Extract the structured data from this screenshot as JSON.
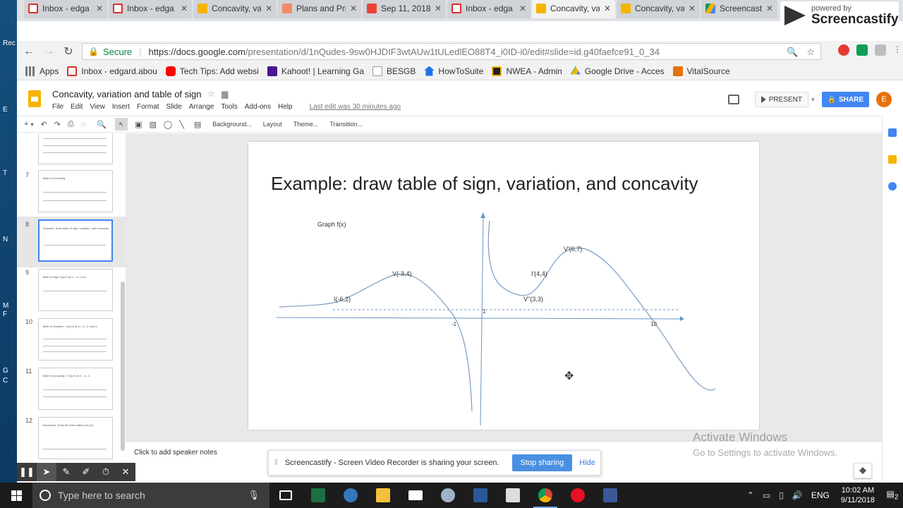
{
  "desktop": {
    "labels": [
      "Rec",
      "E",
      "T",
      "N",
      "M",
      "F",
      "G",
      "C"
    ]
  },
  "tabs": [
    {
      "label": "Inbox - edga",
      "icon": "gmail-icon"
    },
    {
      "label": "Inbox - edga",
      "icon": "gmail-icon"
    },
    {
      "label": "Concavity, va",
      "icon": "slides-icon"
    },
    {
      "label": "Plans and Pri",
      "icon": "plans-icon"
    },
    {
      "label": "Sep 11, 2018",
      "icon": "video-icon"
    },
    {
      "label": "Inbox - edga",
      "icon": "gmail-icon"
    },
    {
      "label": "Concavity, va",
      "icon": "slides-icon",
      "active": true
    },
    {
      "label": "Concavity, va",
      "icon": "slides-icon"
    },
    {
      "label": "Screencastify",
      "icon": "drive-icon"
    }
  ],
  "screencastify_badge": {
    "small": "powered by",
    "big": "Screencastify"
  },
  "omnibox": {
    "secure": "Secure",
    "url_host": "https://docs.google.com",
    "url_path": "/presentation/d/1nQudes-9sw0HJDIF3wtAUw1tULedlEO88T4_i0ID-i0/edit#slide=id.g40faefce91_0_34"
  },
  "bookmarks": [
    {
      "label": "Apps",
      "icon": "apps-icon",
      "color": "#777777"
    },
    {
      "label": "Inbox - edgard.abou",
      "icon": "gmail-icon",
      "color": "#d93025"
    },
    {
      "label": "Tech Tips: Add websi",
      "icon": "youtube-icon",
      "color": "#ff0000"
    },
    {
      "label": "Kahoot! | Learning Ga",
      "icon": "kahoot-icon",
      "color": "#46178f"
    },
    {
      "label": "BESGB",
      "icon": "page-icon",
      "color": "#cccccc"
    },
    {
      "label": "HowToSuite",
      "icon": "home-icon",
      "color": "#1a73e8"
    },
    {
      "label": "NWEA - Admin",
      "icon": "nwea-icon",
      "color": "#222222"
    },
    {
      "label": "Google Drive - Acces",
      "icon": "drive-icon",
      "color": "#0f9d58"
    },
    {
      "label": "VitalSource",
      "icon": "vitalsource-icon",
      "color": "#e8710a"
    }
  ],
  "doc": {
    "title": "Concavity, variation and table of sign",
    "menus": [
      "File",
      "Edit",
      "View",
      "Insert",
      "Format",
      "Slide",
      "Arrange",
      "Tools",
      "Add-ons",
      "Help"
    ],
    "last_edit": "Last edit was 30 minutes ago",
    "present": "PRESENT",
    "share": "SHARE",
    "avatar": "E"
  },
  "edit_toolbar": [
    "Background...",
    "Layout",
    "Theme...",
    "Transition..."
  ],
  "filmstrip": [
    {
      "num": "",
      "title": ""
    },
    {
      "num": "7",
      "title": "Table of Concavity"
    },
    {
      "num": "8",
      "title": "Example: draw table of sign, variation, and concavity",
      "selected": true
    },
    {
      "num": "9",
      "title": "Table of Sign: f(x)=0 at x= -1, x=10"
    },
    {
      "num": "10",
      "title": "Table of Variation : f'(x)=0 at x= -6, -3, and 6"
    },
    {
      "num": "11",
      "title": "Table of concavity : f''(x)=0 at x= -6, -3"
    },
    {
      "num": "12",
      "title": "Homework: Draw the three tables for f(x)"
    }
  ],
  "slide": {
    "title": "Example: draw table of sign, variation, and concavity",
    "graph_label": "Graph f(x)",
    "labels": {
      "i1": "I(-6,2)",
      "v1": "V(-3,4)",
      "v2": "V''(3,3)",
      "i2": "I'(4,4)",
      "v3": "V'(6,7)",
      "minus1": "-1",
      "one": "1",
      "ten": "10"
    }
  },
  "notes_placeholder": "Click to add speaker notes",
  "watermark": {
    "line1": "Activate Windows",
    "line2": "Go to Settings to activate Windows."
  },
  "share_banner": {
    "message": "Screencastify - Screen Video Recorder is sharing your screen.",
    "stop": "Stop sharing",
    "hide": "Hide"
  },
  "taskbar": {
    "search_placeholder": "Type here to search",
    "lang": "ENG",
    "time": "10:02 AM",
    "date": "9/11/2018",
    "notif_count": "2"
  }
}
